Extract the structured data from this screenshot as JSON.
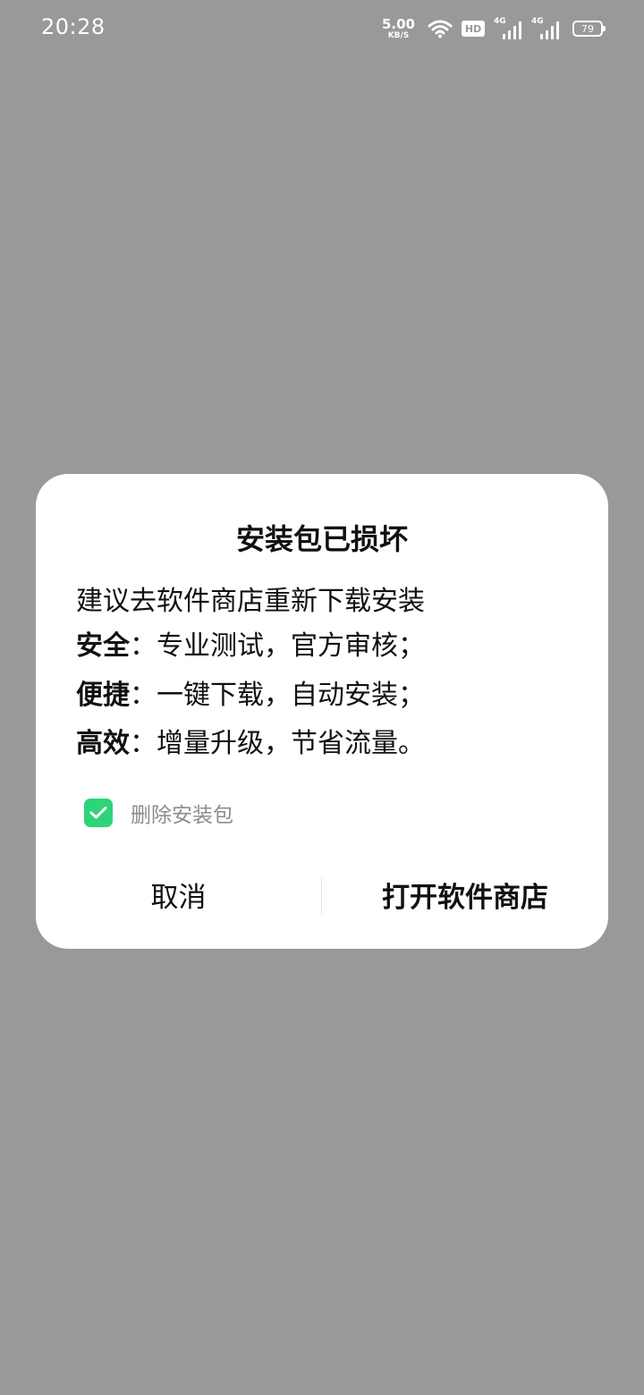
{
  "status_bar": {
    "time": "20:28",
    "net_speed_value": "5.00",
    "net_speed_unit": "KB/S",
    "hd_label": "HD",
    "signal1_label": "4G",
    "signal2_label": "4G",
    "battery_level": "79"
  },
  "dialog": {
    "title": "安装包已损坏",
    "message": "建议去软件商店重新下载安装",
    "features": [
      {
        "label": "安全",
        "separator": "：",
        "text": "专业测试，官方审核；"
      },
      {
        "label": "便捷",
        "separator": "：",
        "text": "一键下载，自动安装；"
      },
      {
        "label": "高效",
        "separator": "：",
        "text": "增量升级，节省流量。"
      }
    ],
    "checkbox": {
      "label": "删除安装包",
      "checked": true,
      "color": "#2ed47a"
    },
    "buttons": {
      "cancel": "取消",
      "open_store": "打开软件商店"
    }
  },
  "colors": {
    "backdrop": "#999999",
    "dialog_bg": "#ffffff",
    "accent": "#2ed47a"
  }
}
